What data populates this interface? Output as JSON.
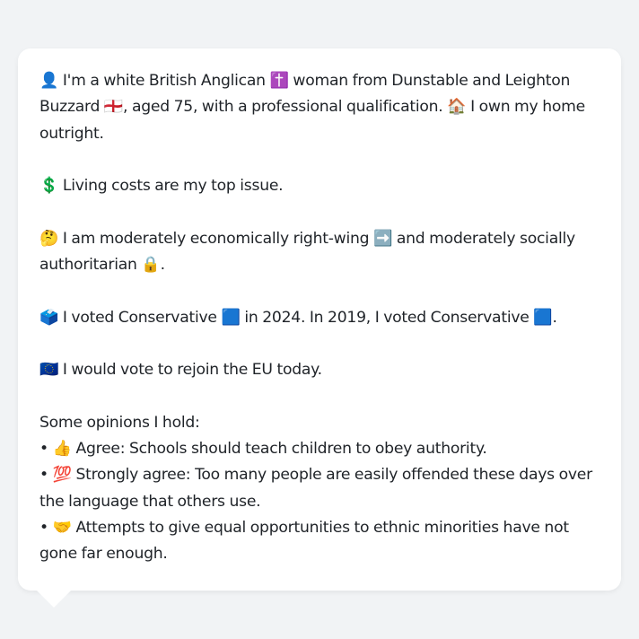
{
  "profile": {
    "identity": "👤 I'm a white British Anglican ✝️ woman from Dunstable and Leighton Buzzard 🏴󠁧󠁢󠁥󠁮󠁧󠁿, aged 75, with a professional qualification. 🏠 I own my home outright.",
    "top_issue": "💲 Living costs are my top issue.",
    "ideology": "🤔 I am moderately economically right-wing ➡️ and moderately socially authoritarian 🔒.",
    "voting": "🗳️ I voted Conservative 🟦 in 2024. In 2019, I voted Conservative 🟦.",
    "eu": "🇪🇺 I would vote to rejoin the EU today.",
    "opinions_header": "Some opinions I hold:",
    "opinions": [
      "• 👍 Agree: Schools should teach children to obey authority.",
      "• 💯 Strongly agree: Too many people are easily offended these days over the language that others use.",
      "• 🤝 Attempts to give equal opportunities to ethnic minorities have not gone far enough."
    ]
  }
}
